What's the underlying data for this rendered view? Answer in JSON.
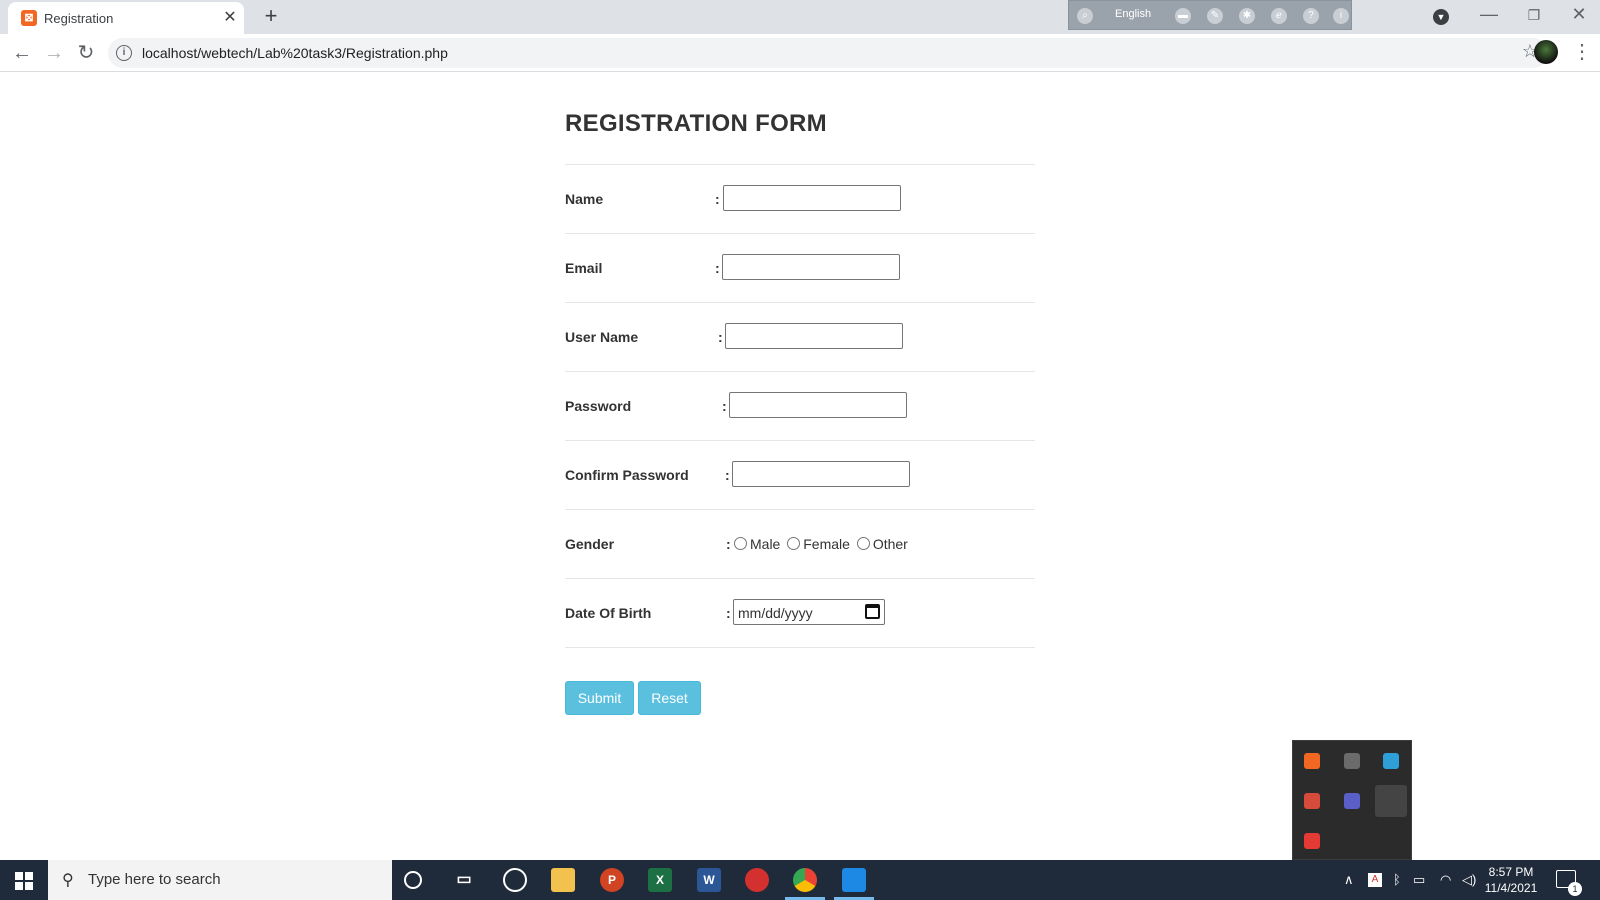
{
  "browser": {
    "tab_title": "Registration",
    "tab_close": "✕",
    "new_tab": "+",
    "lang_bar_language": "English",
    "url": "localhost/webtech/Lab%20task3/Registration.php",
    "back": "←",
    "forward": "→",
    "reload": "↻",
    "info": "i",
    "star": "☆",
    "menu": "⋮",
    "minimize": "—",
    "restore": "❐",
    "close": "✕"
  },
  "form": {
    "title": "REGISTRATION FORM",
    "colon": ":",
    "fields": {
      "name": "Name",
      "email": "Email",
      "username": "User Name",
      "password": "Password",
      "confirm_password": "Confirm Password",
      "gender": "Gender",
      "dob": "Date Of Birth"
    },
    "gender_options": [
      "Male",
      "Female",
      "Other"
    ],
    "dob_placeholder": "mm/dd/yyyy",
    "submit_label": "Submit",
    "reset_label": "Reset"
  },
  "taskbar": {
    "search_placeholder": "Type here to search",
    "clock_time": "8:57 PM",
    "clock_date": "11/4/2021",
    "notification_count": "1",
    "apps": [
      "cortana-icon",
      "task-view-icon",
      "obs-icon",
      "file-explorer-icon",
      "powerpoint-icon",
      "excel-icon",
      "word-icon",
      "app-icon",
      "chrome-icon",
      "vscode-icon"
    ]
  },
  "colors": {
    "button_bg": "#5bc0de",
    "taskbar_bg": "#1f2a3a"
  }
}
